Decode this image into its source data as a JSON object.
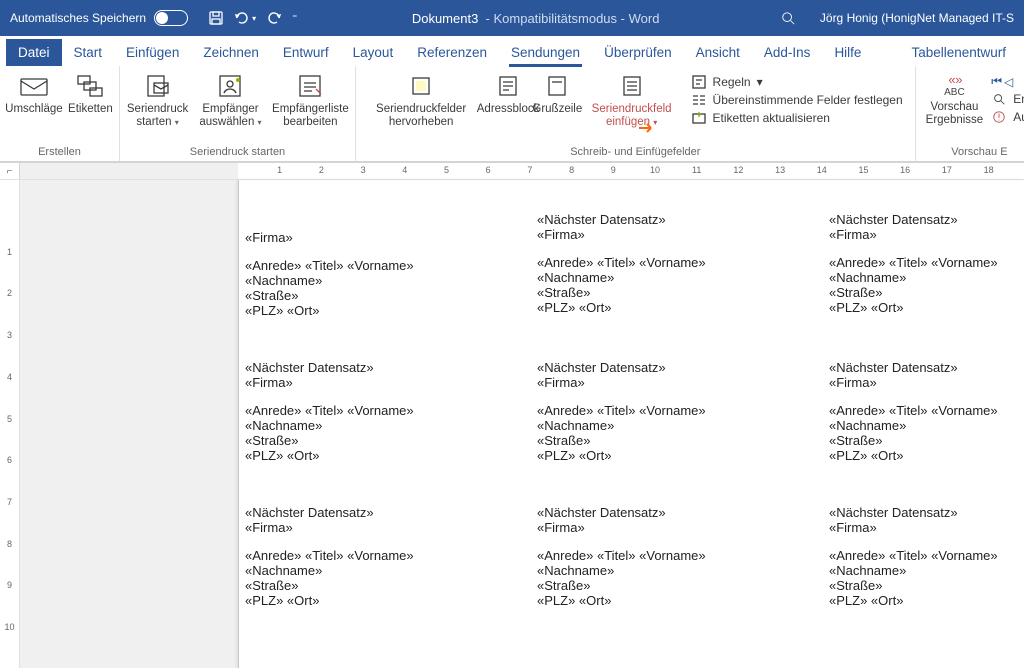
{
  "titlebar": {
    "autosave": "Automatisches Speichern",
    "doc_title": "Dokument3",
    "compat": "Kompatibilitätsmodus",
    "app": "Word",
    "user": "Jörg Honig (HonigNet Managed IT-S"
  },
  "tabs": {
    "datei": "Datei",
    "start": "Start",
    "einfuegen": "Einfügen",
    "zeichnen": "Zeichnen",
    "entwurf": "Entwurf",
    "layout": "Layout",
    "referenzen": "Referenzen",
    "sendungen": "Sendungen",
    "ueberpruefen": "Überprüfen",
    "ansicht": "Ansicht",
    "addins": "Add-Ins",
    "hilfe": "Hilfe",
    "tabellenentwurf": "Tabellenentwurf"
  },
  "ribbon": {
    "erstellen": {
      "label": "Erstellen",
      "umschlaege": "Umschläge",
      "etiketten": "Etiketten"
    },
    "seriendruck_starten": {
      "label": "Seriendruck starten",
      "starten": "Seriendruck starten",
      "empfaenger": "Empfänger auswählen",
      "liste": "Empfängerliste bearbeiten"
    },
    "schreibfelder": {
      "label": "Schreib- und Einfügefelder",
      "hervorheben": "Seriendruckfelder hervorheben",
      "adressblock": "Adressblock",
      "grusszeile": "Grußzeile",
      "einfuegen": "Seriendruckfeld einfügen",
      "regeln": "Regeln",
      "felder_festlegen": "Übereinstimmende Felder festlegen",
      "etiketten_akt": "Etiketten aktualisieren"
    },
    "vorschau": {
      "label": "Vorschau E",
      "ergebnisse": "Vorschau Ergebnisse",
      "abc": "ABC",
      "em": "Em",
      "auf": "Auf"
    }
  },
  "ruler": {
    "h": [
      "1",
      "2",
      "3",
      "4",
      "5",
      "6",
      "7",
      "8",
      "9",
      "10",
      "11",
      "12",
      "13",
      "14",
      "15",
      "16",
      "17",
      "18"
    ],
    "v": [
      "1",
      "2",
      "3",
      "4",
      "5",
      "6",
      "7",
      "8",
      "9",
      "10"
    ]
  },
  "labels": {
    "naechster": "«Nächster Datensatz»",
    "firma": "«Firma»",
    "row2": "«Anrede» «Titel» «Vorname»",
    "row3": " «Nachname»",
    "strasse": "«Straße»",
    "plzort": "«PLZ» «Ort»"
  }
}
